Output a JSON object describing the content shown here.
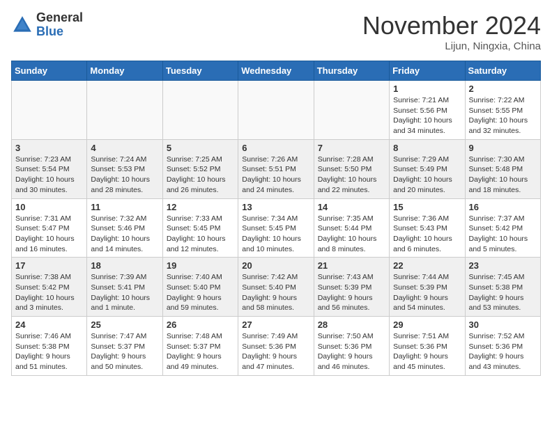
{
  "header": {
    "logo_general": "General",
    "logo_blue": "Blue",
    "month_title": "November 2024",
    "location": "Lijun, Ningxia, China"
  },
  "weekdays": [
    "Sunday",
    "Monday",
    "Tuesday",
    "Wednesday",
    "Thursday",
    "Friday",
    "Saturday"
  ],
  "weeks": [
    [
      {
        "day": "",
        "empty": true
      },
      {
        "day": "",
        "empty": true
      },
      {
        "day": "",
        "empty": true
      },
      {
        "day": "",
        "empty": true
      },
      {
        "day": "",
        "empty": true
      },
      {
        "day": "1",
        "sunrise": "Sunrise: 7:21 AM",
        "sunset": "Sunset: 5:56 PM",
        "daylight": "Daylight: 10 hours and 34 minutes."
      },
      {
        "day": "2",
        "sunrise": "Sunrise: 7:22 AM",
        "sunset": "Sunset: 5:55 PM",
        "daylight": "Daylight: 10 hours and 32 minutes."
      }
    ],
    [
      {
        "day": "3",
        "sunrise": "Sunrise: 7:23 AM",
        "sunset": "Sunset: 5:54 PM",
        "daylight": "Daylight: 10 hours and 30 minutes."
      },
      {
        "day": "4",
        "sunrise": "Sunrise: 7:24 AM",
        "sunset": "Sunset: 5:53 PM",
        "daylight": "Daylight: 10 hours and 28 minutes."
      },
      {
        "day": "5",
        "sunrise": "Sunrise: 7:25 AM",
        "sunset": "Sunset: 5:52 PM",
        "daylight": "Daylight: 10 hours and 26 minutes."
      },
      {
        "day": "6",
        "sunrise": "Sunrise: 7:26 AM",
        "sunset": "Sunset: 5:51 PM",
        "daylight": "Daylight: 10 hours and 24 minutes."
      },
      {
        "day": "7",
        "sunrise": "Sunrise: 7:28 AM",
        "sunset": "Sunset: 5:50 PM",
        "daylight": "Daylight: 10 hours and 22 minutes."
      },
      {
        "day": "8",
        "sunrise": "Sunrise: 7:29 AM",
        "sunset": "Sunset: 5:49 PM",
        "daylight": "Daylight: 10 hours and 20 minutes."
      },
      {
        "day": "9",
        "sunrise": "Sunrise: 7:30 AM",
        "sunset": "Sunset: 5:48 PM",
        "daylight": "Daylight: 10 hours and 18 minutes."
      }
    ],
    [
      {
        "day": "10",
        "sunrise": "Sunrise: 7:31 AM",
        "sunset": "Sunset: 5:47 PM",
        "daylight": "Daylight: 10 hours and 16 minutes."
      },
      {
        "day": "11",
        "sunrise": "Sunrise: 7:32 AM",
        "sunset": "Sunset: 5:46 PM",
        "daylight": "Daylight: 10 hours and 14 minutes."
      },
      {
        "day": "12",
        "sunrise": "Sunrise: 7:33 AM",
        "sunset": "Sunset: 5:45 PM",
        "daylight": "Daylight: 10 hours and 12 minutes."
      },
      {
        "day": "13",
        "sunrise": "Sunrise: 7:34 AM",
        "sunset": "Sunset: 5:45 PM",
        "daylight": "Daylight: 10 hours and 10 minutes."
      },
      {
        "day": "14",
        "sunrise": "Sunrise: 7:35 AM",
        "sunset": "Sunset: 5:44 PM",
        "daylight": "Daylight: 10 hours and 8 minutes."
      },
      {
        "day": "15",
        "sunrise": "Sunrise: 7:36 AM",
        "sunset": "Sunset: 5:43 PM",
        "daylight": "Daylight: 10 hours and 6 minutes."
      },
      {
        "day": "16",
        "sunrise": "Sunrise: 7:37 AM",
        "sunset": "Sunset: 5:42 PM",
        "daylight": "Daylight: 10 hours and 5 minutes."
      }
    ],
    [
      {
        "day": "17",
        "sunrise": "Sunrise: 7:38 AM",
        "sunset": "Sunset: 5:42 PM",
        "daylight": "Daylight: 10 hours and 3 minutes."
      },
      {
        "day": "18",
        "sunrise": "Sunrise: 7:39 AM",
        "sunset": "Sunset: 5:41 PM",
        "daylight": "Daylight: 10 hours and 1 minute."
      },
      {
        "day": "19",
        "sunrise": "Sunrise: 7:40 AM",
        "sunset": "Sunset: 5:40 PM",
        "daylight": "Daylight: 9 hours and 59 minutes."
      },
      {
        "day": "20",
        "sunrise": "Sunrise: 7:42 AM",
        "sunset": "Sunset: 5:40 PM",
        "daylight": "Daylight: 9 hours and 58 minutes."
      },
      {
        "day": "21",
        "sunrise": "Sunrise: 7:43 AM",
        "sunset": "Sunset: 5:39 PM",
        "daylight": "Daylight: 9 hours and 56 minutes."
      },
      {
        "day": "22",
        "sunrise": "Sunrise: 7:44 AM",
        "sunset": "Sunset: 5:39 PM",
        "daylight": "Daylight: 9 hours and 54 minutes."
      },
      {
        "day": "23",
        "sunrise": "Sunrise: 7:45 AM",
        "sunset": "Sunset: 5:38 PM",
        "daylight": "Daylight: 9 hours and 53 minutes."
      }
    ],
    [
      {
        "day": "24",
        "sunrise": "Sunrise: 7:46 AM",
        "sunset": "Sunset: 5:38 PM",
        "daylight": "Daylight: 9 hours and 51 minutes."
      },
      {
        "day": "25",
        "sunrise": "Sunrise: 7:47 AM",
        "sunset": "Sunset: 5:37 PM",
        "daylight": "Daylight: 9 hours and 50 minutes."
      },
      {
        "day": "26",
        "sunrise": "Sunrise: 7:48 AM",
        "sunset": "Sunset: 5:37 PM",
        "daylight": "Daylight: 9 hours and 49 minutes."
      },
      {
        "day": "27",
        "sunrise": "Sunrise: 7:49 AM",
        "sunset": "Sunset: 5:36 PM",
        "daylight": "Daylight: 9 hours and 47 minutes."
      },
      {
        "day": "28",
        "sunrise": "Sunrise: 7:50 AM",
        "sunset": "Sunset: 5:36 PM",
        "daylight": "Daylight: 9 hours and 46 minutes."
      },
      {
        "day": "29",
        "sunrise": "Sunrise: 7:51 AM",
        "sunset": "Sunset: 5:36 PM",
        "daylight": "Daylight: 9 hours and 45 minutes."
      },
      {
        "day": "30",
        "sunrise": "Sunrise: 7:52 AM",
        "sunset": "Sunset: 5:36 PM",
        "daylight": "Daylight: 9 hours and 43 minutes."
      }
    ]
  ]
}
